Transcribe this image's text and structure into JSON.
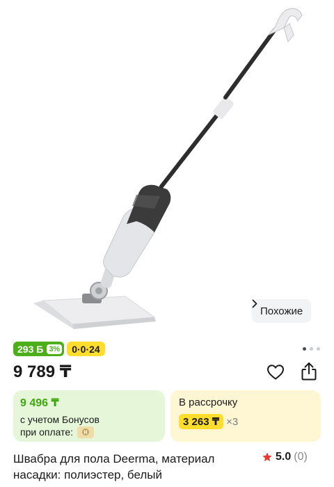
{
  "gallery": {
    "similar_label": "Похожие",
    "dots_count": 3,
    "active_dot": 0
  },
  "badges": {
    "bonus_value": "293 Б",
    "bonus_percent": "3%",
    "installment": "0·0·24"
  },
  "price": "9 789 ₸",
  "bonus_card": {
    "amount": "9 496 ₸",
    "line1": "с учетом Бонусов",
    "line2": "при оплате:"
  },
  "installment_card": {
    "title": "В рассрочку",
    "monthly": "3 263 ₸",
    "multiplier": "×3"
  },
  "product": {
    "title": "Швабра для пола Deerma, материал насадки: полиэстер, белый",
    "rating": "5.0",
    "reviews": "(0)"
  },
  "colors": {
    "green": "#4caf1a",
    "yellow": "#ffdd2d",
    "star": "#e53935"
  }
}
